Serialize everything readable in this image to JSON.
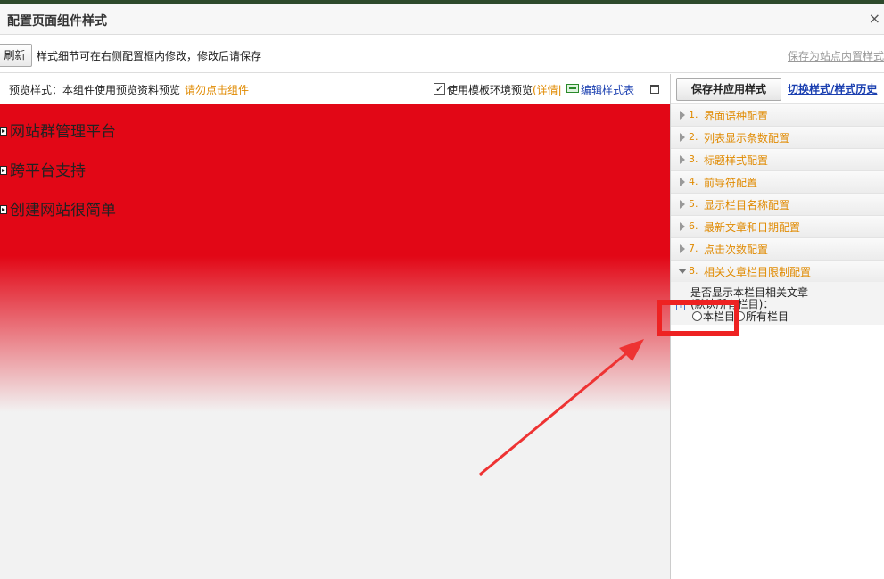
{
  "dialog": {
    "title": "配置页面组件样式",
    "close_glyph": "×"
  },
  "toolbar": {
    "refresh_label": "刷新",
    "hint": "样式细节可在右侧配置框内修改，修改后请保存",
    "save_builtin_label": "保存为站点内置样式"
  },
  "preview_bar": {
    "label": "预览样式：本组件使用预览资料预览",
    "warn": "请勿点击组件",
    "template_preview_checked": true,
    "check_glyph": "✓",
    "template_preview_label": "使用模板环境预览",
    "detail_label": "(详情|",
    "edit_icon": "edit-style-icon",
    "edit_style_label": "编辑样式表",
    "window_icon": "window-icon"
  },
  "preview": {
    "nav_items": [
      "网站群管理平台",
      "跨平台支持",
      "创建网站很简单"
    ],
    "colors": {
      "banner_red": "#e20716",
      "background_gray": "#f2f2f2"
    }
  },
  "right_panel": {
    "apply_label": "保存并应用样式",
    "switch_label": "切换样式/样式历史",
    "sections": [
      {
        "num": "1.",
        "label": "界面语种配置",
        "expanded": false
      },
      {
        "num": "2.",
        "label": "列表显示条数配置",
        "expanded": false
      },
      {
        "num": "3.",
        "label": "标题样式配置",
        "expanded": false
      },
      {
        "num": "4.",
        "label": "前导符配置",
        "expanded": false
      },
      {
        "num": "5.",
        "label": "显示栏目名称配置",
        "expanded": false
      },
      {
        "num": "6.",
        "label": "最新文章和日期配置",
        "expanded": false
      },
      {
        "num": "7.",
        "label": "点击次数配置",
        "expanded": false
      },
      {
        "num": "8.",
        "label": "相关文章栏目限制配置",
        "expanded": true
      }
    ],
    "related_config": {
      "info_glyph": "i",
      "question_line1": "是否显示本栏目相关文章",
      "question_line2": "(默认所有栏目)：",
      "options": [
        "本栏目",
        "所有栏目"
      ]
    }
  },
  "annotation": {
    "color": "#ee2222"
  }
}
